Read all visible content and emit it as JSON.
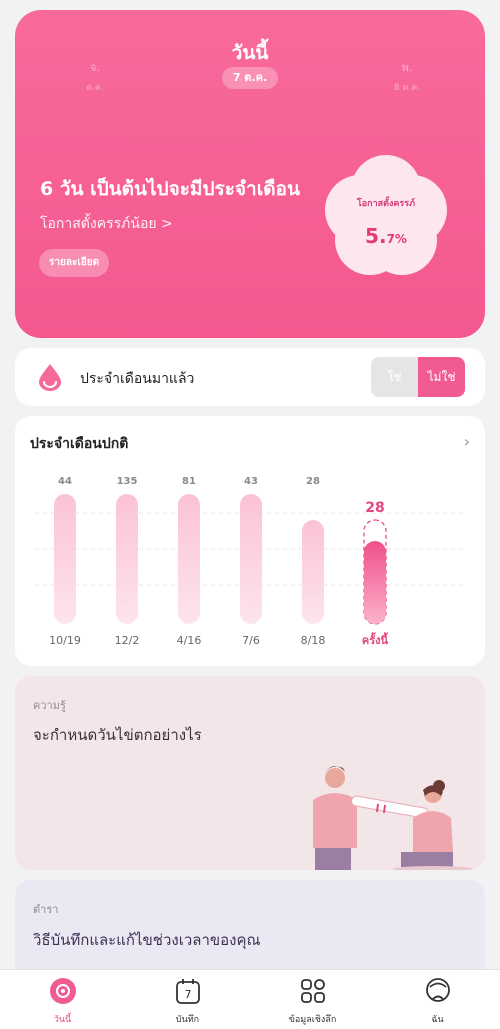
{
  "hero": {
    "prev_day": {
      "line1": "จ.",
      "line2": "ต.ค."
    },
    "next_day": {
      "line1": "พ.",
      "line2": "8 ต.ค."
    },
    "today_label": "วันนี้",
    "date_label": "7 ต.ค.",
    "period_countdown": "6 วัน เป็นต้นไปจะมีประจำเดือน",
    "pregnancy_link": "โอกาสตั้งครรภ์น้อย >",
    "details_button": "รายละเอียด",
    "pregnancy_chance": {
      "label": "โอกาสตั้งครรภ์",
      "value": "5.",
      "decimal": "7%"
    }
  },
  "arrived": {
    "label": "ประจำเดือนมาแล้ว",
    "yes": "ใช่",
    "no": "ไม่ใช่"
  },
  "cycle_card": {
    "title": "ประจำเดือนปกติ"
  },
  "chart_data": {
    "type": "bar",
    "categories": [
      "10/19",
      "12/2",
      "4/16",
      "7/6",
      "8/18",
      "ครั้งนี้"
    ],
    "values": [
      44,
      135,
      81,
      43,
      28,
      28
    ],
    "highlight_index": 5
  },
  "knowledge": {
    "tag": "ความรู้",
    "title": "จะกำหนดวันไข่ตกอย่างไร"
  },
  "tips": {
    "tag": "ตำรา",
    "title": "วิธีบันทึกและแก้ไขช่วงเวลาของคุณ"
  },
  "tabs": [
    {
      "label": "วันนี้",
      "icon": "today-icon",
      "active": true
    },
    {
      "label": "บันทึก",
      "icon": "calendar-7-icon",
      "calendar_number": "7",
      "active": false
    },
    {
      "label": "ข้อมูลเชิงลึก",
      "icon": "grid-icon",
      "active": false
    },
    {
      "label": "ฉัน",
      "icon": "profile-icon",
      "active": false
    }
  ],
  "colors": {
    "accent": "#f25a92",
    "hero": "#f86a9c"
  }
}
